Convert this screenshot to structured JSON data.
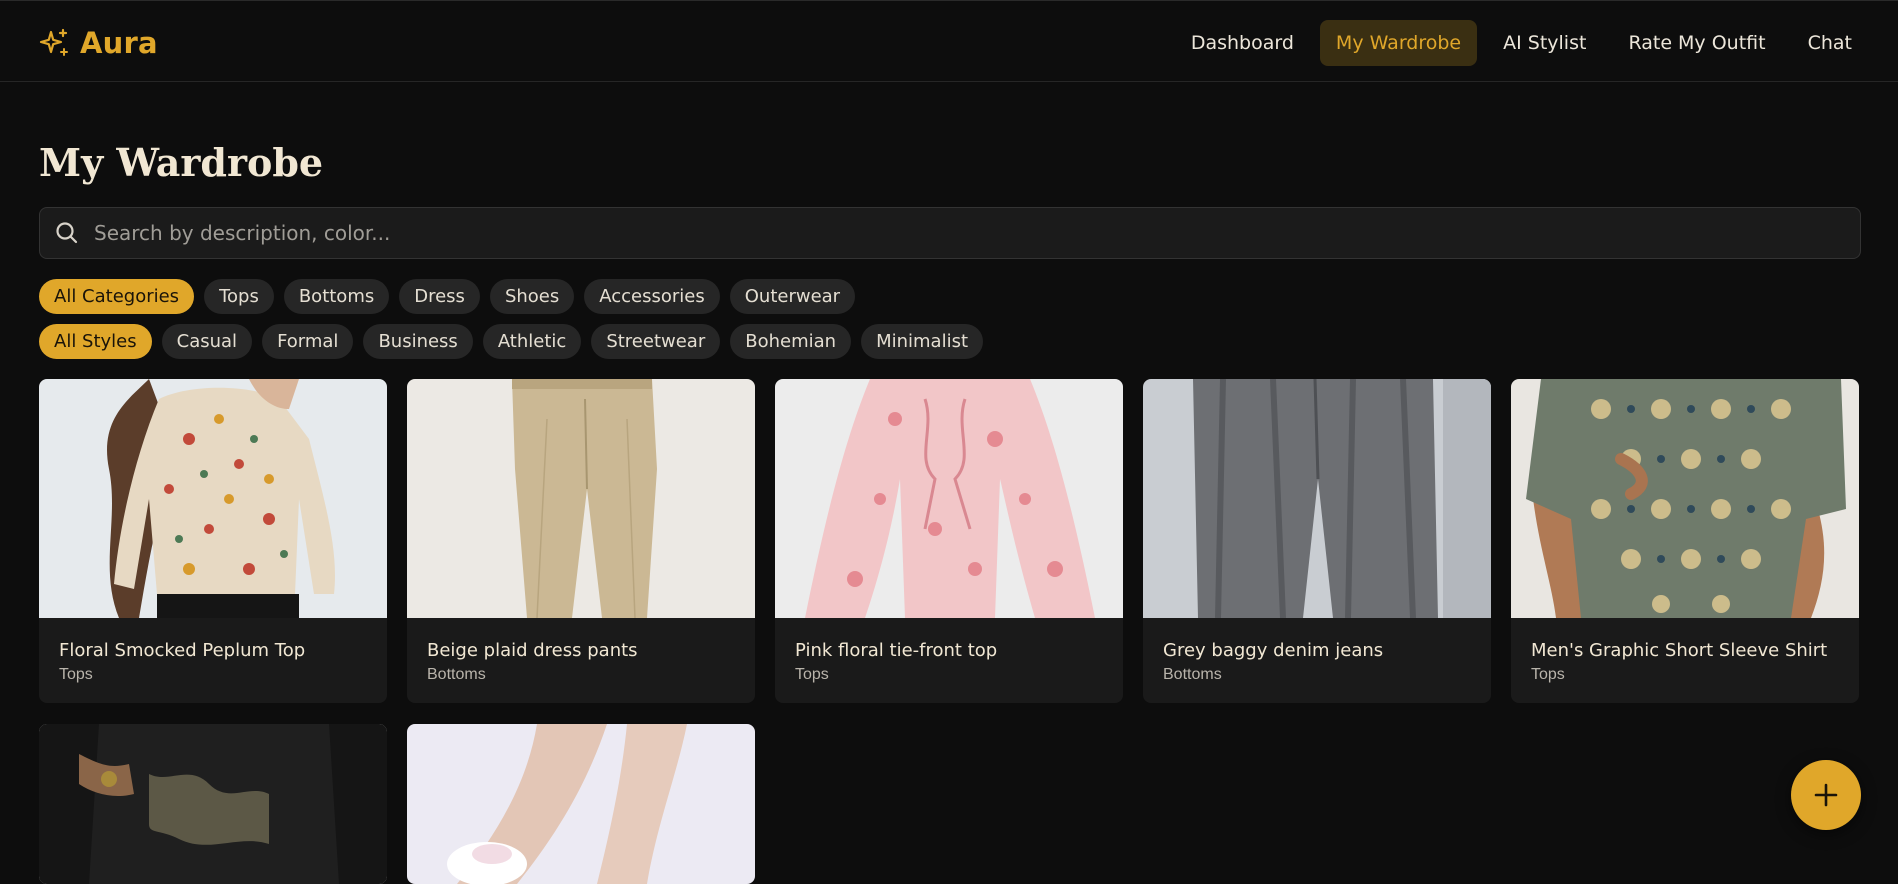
{
  "app": {
    "brand_name": "Aura",
    "brand_icon": "sparkles-icon",
    "accent_color": "#e0a72a"
  },
  "nav": {
    "items": [
      {
        "label": "Dashboard",
        "active": false
      },
      {
        "label": "My Wardrobe",
        "active": true
      },
      {
        "label": "AI Stylist",
        "active": false
      },
      {
        "label": "Rate My Outfit",
        "active": false
      },
      {
        "label": "Chat",
        "active": false
      }
    ]
  },
  "page": {
    "title": "My Wardrobe"
  },
  "search": {
    "placeholder": "Search by description, color...",
    "value": "",
    "icon": "search-icon"
  },
  "filters": {
    "categories": [
      "All Categories",
      "Tops",
      "Bottoms",
      "Dress",
      "Shoes",
      "Accessories",
      "Outerwear"
    ],
    "selected_category": "All Categories",
    "styles": [
      "All Styles",
      "Casual",
      "Formal",
      "Business",
      "Athletic",
      "Streetwear",
      "Bohemian",
      "Minimalist"
    ],
    "selected_style": "All Styles"
  },
  "items": [
    {
      "name": "Floral Smocked Peplum Top",
      "category": "Tops"
    },
    {
      "name": "Beige plaid dress pants",
      "category": "Bottoms"
    },
    {
      "name": "Pink floral tie-front top",
      "category": "Tops"
    },
    {
      "name": "Grey baggy denim jeans",
      "category": "Bottoms"
    },
    {
      "name": "Men's Graphic Short Sleeve Shirt",
      "category": "Tops"
    }
  ],
  "fab": {
    "icon": "plus-icon"
  }
}
